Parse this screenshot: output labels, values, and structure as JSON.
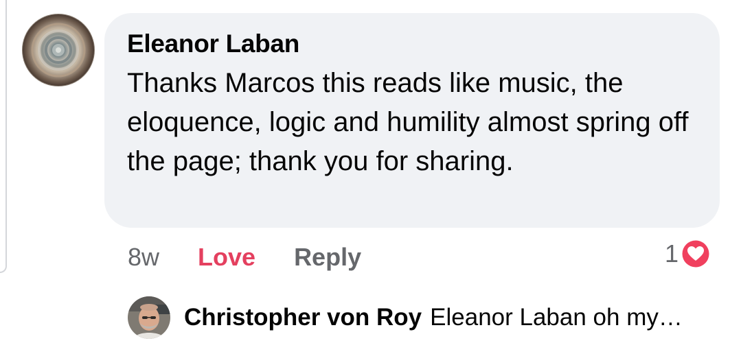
{
  "comment": {
    "author": "Eleanor Laban",
    "text": "Thanks Marcos this reads like music, the eloquence, logic and humility almost spring off the page; thank you for sharing.",
    "time": "8w",
    "love_label": "Love",
    "reply_label": "Reply",
    "reaction_count": "1",
    "reaction_icon": "heart-icon",
    "colors": {
      "love": "#e4405f",
      "bubble": "#f0f2f5",
      "muted": "#65676b"
    }
  },
  "reply_preview": {
    "author": "Christopher von Roy",
    "text": "Eleanor Laban oh my…"
  }
}
